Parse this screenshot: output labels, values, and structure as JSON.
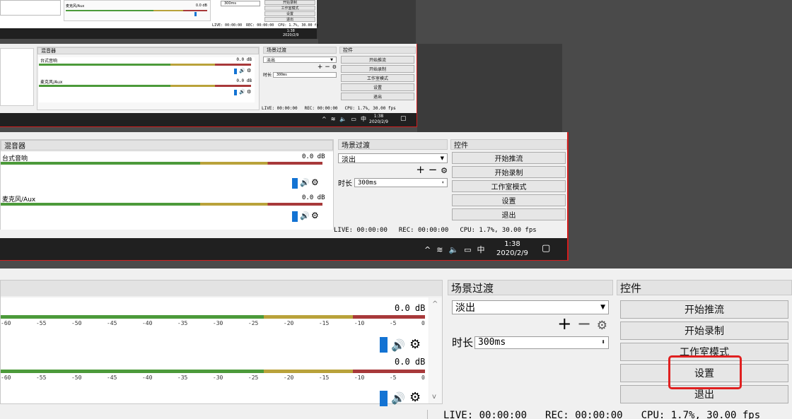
{
  "level1": {
    "mixer_title": "混音器",
    "transition_title": "场景过渡",
    "controls_title": "控件",
    "channels": [
      {
        "name": "台式音响",
        "db": "0.0 dB"
      },
      {
        "name": "麦克风/Aux",
        "db": "0.0 dB"
      }
    ],
    "ticks": [
      "-60",
      "-55",
      "-50",
      "-45",
      "-40",
      "-35",
      "-30",
      "-25",
      "-20",
      "-15",
      "-10",
      "-5",
      "0"
    ],
    "transition": {
      "selected": "淡出",
      "duration_label": "时长",
      "duration_value": "300ms"
    },
    "buttons": [
      "开始推流",
      "开始录制",
      "工作室模式",
      "设置",
      "退出"
    ],
    "status": {
      "live": "LIVE: 00:00:00",
      "rec": "REC: 00:00:00",
      "cpu": "CPU: 1.7%, 30.00 fps"
    },
    "taskbar": {
      "ime": "中",
      "time": "1:38",
      "date": "2020/2/9"
    }
  },
  "level2": {
    "mixer_title": "混音器",
    "transition_title": "场景过渡",
    "controls_title": "控件",
    "channels": [
      {
        "name": "台式音响",
        "db": "0.0 dB"
      },
      {
        "name": "麦克风/Aux",
        "db": "0.0 dB"
      }
    ],
    "transition": {
      "selected": "淡出",
      "duration_label": "时长",
      "duration_value": "300ms"
    },
    "buttons": [
      "开始推流",
      "开始录制",
      "工作室模式",
      "设置",
      "退出"
    ],
    "status": {
      "live": "LIVE: 00:00:00",
      "rec": "REC: 00:00:00",
      "cpu": "CPU: 1.7%, 30.00 fps"
    },
    "taskbar": {
      "ime": "中",
      "time": "1:38",
      "date": "2020/2/9"
    }
  },
  "level3": {
    "channel": "麦克风/Aux",
    "db": "0.0 dB",
    "duration_value": "300ms",
    "buttons": [
      "开始推流",
      "开始录制",
      "工作室模式",
      "设置",
      "退出"
    ],
    "status": {
      "live": "LIVE: 00:00:00",
      "rec": "REC: 00:00:00",
      "cpu": "CPU: 1.7%, 30.00 fps"
    },
    "taskbar": {
      "time": "1:38",
      "date": "2020/2/9"
    }
  },
  "highlight_color": "#e02020"
}
